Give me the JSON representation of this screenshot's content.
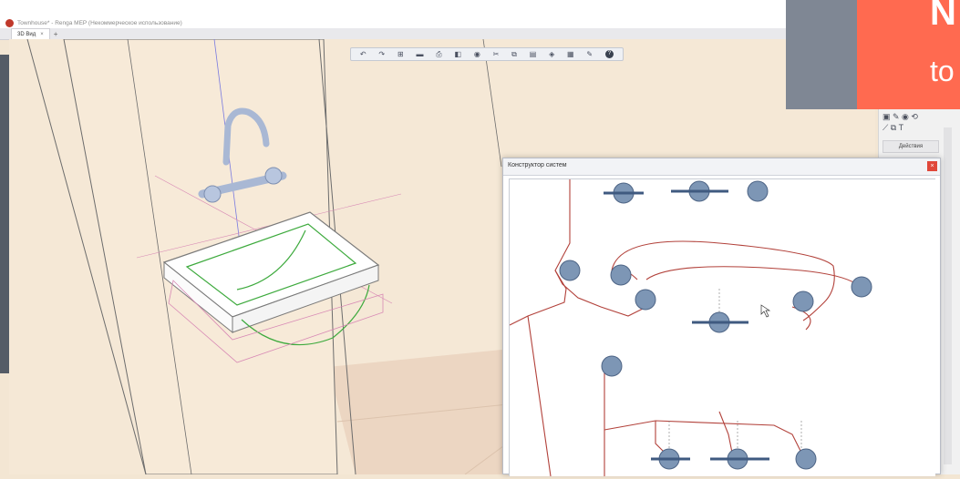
{
  "window": {
    "title": "Townhouse* - Renga MEP (Некоммерческое использование)"
  },
  "tabs": [
    {
      "label": "3D Вид",
      "close": "×"
    }
  ],
  "tab_add": "+",
  "toolbar": {
    "icons": [
      "undo-icon",
      "redo-icon",
      "view-icon",
      "rect-icon",
      "print-icon",
      "camera-icon",
      "globe-icon",
      "cut-icon",
      "copy-icon",
      "paste-icon",
      "eye-icon",
      "layers-icon",
      "wrench-icon",
      "help-icon"
    ],
    "help_glyph": "?"
  },
  "dialog": {
    "title": "Конструктор систем",
    "close": "×"
  },
  "right_panel": {
    "label": "Действия",
    "icons_line1": "▣ ✎ ◉ ⟲",
    "icons_line2": "⟋ ⧉ T"
  },
  "promo": {
    "big": "N",
    "small": "to"
  },
  "colors": {
    "accent": "#ff6a50",
    "line": "#b2413a",
    "node": "#7d96b5"
  }
}
